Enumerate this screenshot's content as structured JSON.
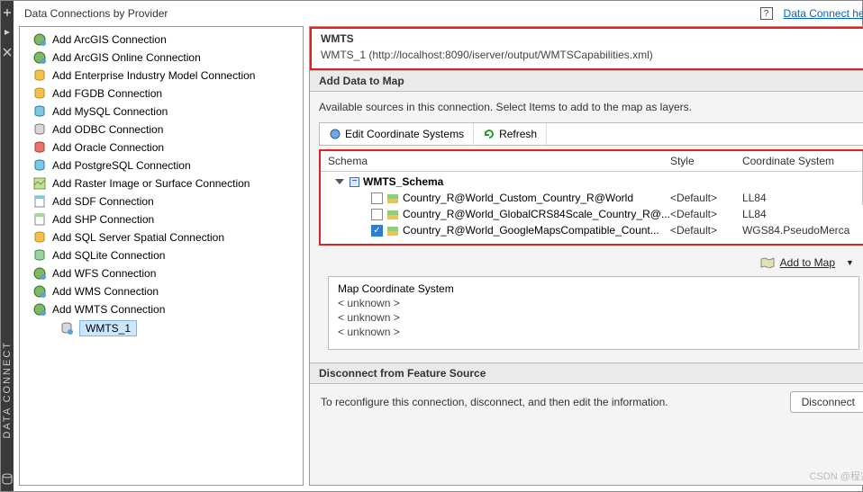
{
  "rail": {
    "vertical_label": "DATA CONNECT"
  },
  "header": {
    "title": "Data Connections by Provider",
    "help_icon": "?",
    "help_link": "Data Connect help"
  },
  "tree": {
    "items": [
      "Add ArcGIS Connection",
      "Add ArcGIS Online Connection",
      "Add Enterprise Industry Model Connection",
      "Add FGDB Connection",
      "Add MySQL Connection",
      "Add ODBC Connection",
      "Add Oracle Connection",
      "Add PostgreSQL Connection",
      "Add Raster Image or Surface Connection",
      "Add SDF Connection",
      "Add SHP Connection",
      "Add SQL Server Spatial Connection",
      "Add SQLite Connection",
      "Add WFS Connection",
      "Add WMS Connection",
      "Add WMTS Connection"
    ],
    "selected_child": "WMTS_1"
  },
  "wmts": {
    "title": "WMTS",
    "detail": "WMTS_1 (http://localhost:8090/iserver/output/WMTSCapabilities.xml)"
  },
  "add_section": {
    "header": "Add Data to Map",
    "available": "Available sources in this connection.  Select Items to add to the map as layers.",
    "edit_cs": "Edit Coordinate Systems",
    "refresh": "Refresh"
  },
  "schema": {
    "cols": {
      "c1": "Schema",
      "c2": "Style",
      "c3": "Coordinate System"
    },
    "root": "WMTS_Schema",
    "rows": [
      {
        "checked": false,
        "name": "Country_R@World_Custom_Country_R@World",
        "style": "<Default>",
        "cs": "LL84"
      },
      {
        "checked": false,
        "name": "Country_R@World_GlobalCRS84Scale_Country_R@...",
        "style": "<Default>",
        "cs": "LL84"
      },
      {
        "checked": true,
        "name": "Country_R@World_GoogleMapsCompatible_Count...",
        "style": "<Default>",
        "cs": "WGS84.PseudoMerca"
      }
    ]
  },
  "add_to_map": {
    "label_prefix": "A",
    "label_underlined": "Add to Map"
  },
  "mcs": {
    "title": "Map Coordinate System",
    "lines": [
      "< unknown >",
      "< unknown >",
      "< unknown >"
    ]
  },
  "disconnect": {
    "header": "Disconnect from Feature Source",
    "text": "To reconfigure this connection, disconnect, and then edit the information.",
    "button": "Disconnect"
  },
  "watermark": "CSDN @程贤"
}
